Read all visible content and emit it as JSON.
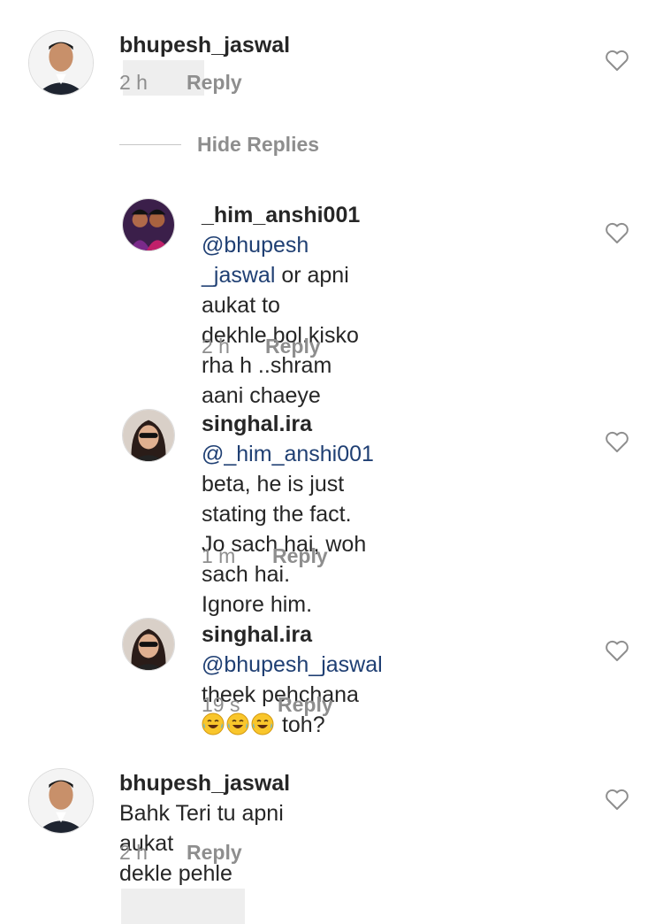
{
  "comments": [
    {
      "username": "bhupesh_jaswal",
      "mention": "",
      "text": "",
      "time": "2 h",
      "reply_label": "Reply"
    },
    {
      "username": "_him_anshi001",
      "mention": "@bhupesh",
      "mention_cont": "_jaswal",
      "text_line1_rest": " or apni aukat to",
      "text_line2": "dekhle bol.kisko rha h ..shram",
      "text_line3": "aani chaeye",
      "time": "2 h",
      "reply_label": "Reply"
    },
    {
      "username": "singhal.ira",
      "mention": "@_him_anshi001",
      "text_line1": "beta, he is just stating the fact.",
      "text_line2": "Jo sach hai, woh sach hai.",
      "text_line3": "Ignore him.",
      "time": "1 m",
      "reply_label": "Reply"
    },
    {
      "username": "singhal.ira",
      "mention": "@bhupesh_jaswal",
      "text_line1": "theek pehchana",
      "text_after_emoji": "toh?",
      "time": "19 s",
      "reply_label": "Reply"
    },
    {
      "username": "bhupesh_jaswal",
      "text_line0": "Bahk Teri tu apni aukat",
      "text_line1": "dekle pehle",
      "time": "2 h",
      "reply_label": "Reply"
    }
  ],
  "hide_replies_label": "Hide Replies",
  "icons": {
    "like": "heart-outline-icon",
    "laugh": "tears-of-joy-emoji"
  },
  "colors": {
    "mention": "#1f3f73",
    "meta": "#8e8e8e",
    "text": "#262626"
  }
}
